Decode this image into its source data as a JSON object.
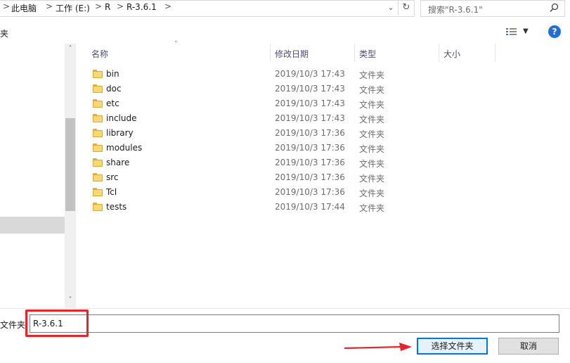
{
  "address": {
    "breadcrumbs": [
      "此电脑",
      "工作 (E:)",
      "R",
      "R-3.6.1"
    ],
    "separator": ">"
  },
  "search": {
    "placeholder": "搜索\"R-3.6.1\""
  },
  "toolbar": {
    "left_label": "夹",
    "help_label": "?"
  },
  "columns": {
    "name": "名称",
    "modified": "修改日期",
    "type": "类型",
    "size": "大小"
  },
  "files": [
    {
      "name": "bin",
      "modified": "2019/10/3 17:43",
      "type": "文件夹"
    },
    {
      "name": "doc",
      "modified": "2019/10/3 17:43",
      "type": "文件夹"
    },
    {
      "name": "etc",
      "modified": "2019/10/3 17:43",
      "type": "文件夹"
    },
    {
      "name": "include",
      "modified": "2019/10/3 17:43",
      "type": "文件夹"
    },
    {
      "name": "library",
      "modified": "2019/10/3 17:36",
      "type": "文件夹"
    },
    {
      "name": "modules",
      "modified": "2019/10/3 17:36",
      "type": "文件夹"
    },
    {
      "name": "share",
      "modified": "2019/10/3 17:36",
      "type": "文件夹"
    },
    {
      "name": "src",
      "modified": "2019/10/3 17:36",
      "type": "文件夹"
    },
    {
      "name": "Tcl",
      "modified": "2019/10/3 17:36",
      "type": "文件夹"
    },
    {
      "name": "tests",
      "modified": "2019/10/3 17:44",
      "type": "文件夹"
    }
  ],
  "footer": {
    "folder_label": "文件夹",
    "folder_value": "R-3.6.1",
    "select_button": "选择文件夹",
    "cancel_button": "取消"
  },
  "colors": {
    "accent": "#0078d7",
    "highlight": "#e8242b",
    "folder": "#f8d775"
  }
}
